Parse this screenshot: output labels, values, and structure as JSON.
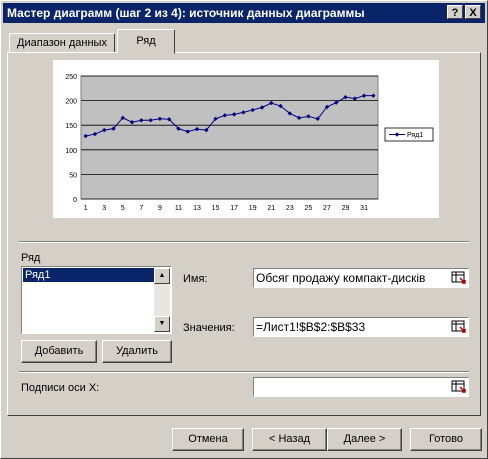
{
  "window": {
    "title": "Мастер диаграмм (шаг 2 из 4): источник данных диаграммы",
    "help_btn": "?",
    "close_btn": "X"
  },
  "tabs": [
    {
      "label": "Диапазон данных",
      "active": false
    },
    {
      "label": "Ряд",
      "active": true
    }
  ],
  "chart_data": {
    "type": "line",
    "x": [
      1,
      2,
      3,
      4,
      5,
      6,
      7,
      8,
      9,
      10,
      11,
      12,
      13,
      14,
      15,
      16,
      17,
      18,
      19,
      20,
      21,
      22,
      23,
      24,
      25,
      26,
      27,
      28,
      29,
      30,
      31,
      32
    ],
    "x_tick_labels": [
      "1",
      "3",
      "5",
      "7",
      "9",
      "11",
      "13",
      "15",
      "17",
      "19",
      "21",
      "23",
      "25",
      "27",
      "29",
      "31"
    ],
    "series": [
      {
        "name": "Ряд1",
        "values": [
          128,
          132,
          140,
          143,
          165,
          156,
          160,
          160,
          163,
          162,
          143,
          137,
          142,
          140,
          163,
          170,
          172,
          176,
          181,
          186,
          195,
          189,
          174,
          165,
          168,
          163,
          187,
          196,
          207,
          204,
          210,
          210
        ],
        "color": "#000080"
      }
    ],
    "ylim": [
      0,
      250
    ],
    "y_ticks": [
      "0",
      "50",
      "100",
      "150",
      "200",
      "250"
    ],
    "grid": true,
    "plot_bg": "#c0c0c0",
    "legend": "right"
  },
  "series_section": {
    "label": "Ряд",
    "items": [
      "Ряд1"
    ],
    "selected": "Ряд1"
  },
  "add_button": "Добавить",
  "remove_button": "Удалить",
  "name_field": {
    "label": "Имя:",
    "value": "Обсяг продажу компакт-дисків"
  },
  "values_field": {
    "label": "Значения:",
    "value": "=Лист1!$B$2:$B$33"
  },
  "xlabels_field": {
    "label": "Подписи оси X:",
    "value": ""
  },
  "footer": {
    "cancel": "Отмена",
    "back": "< Назад",
    "next": "Далее >",
    "finish": "Готово"
  }
}
